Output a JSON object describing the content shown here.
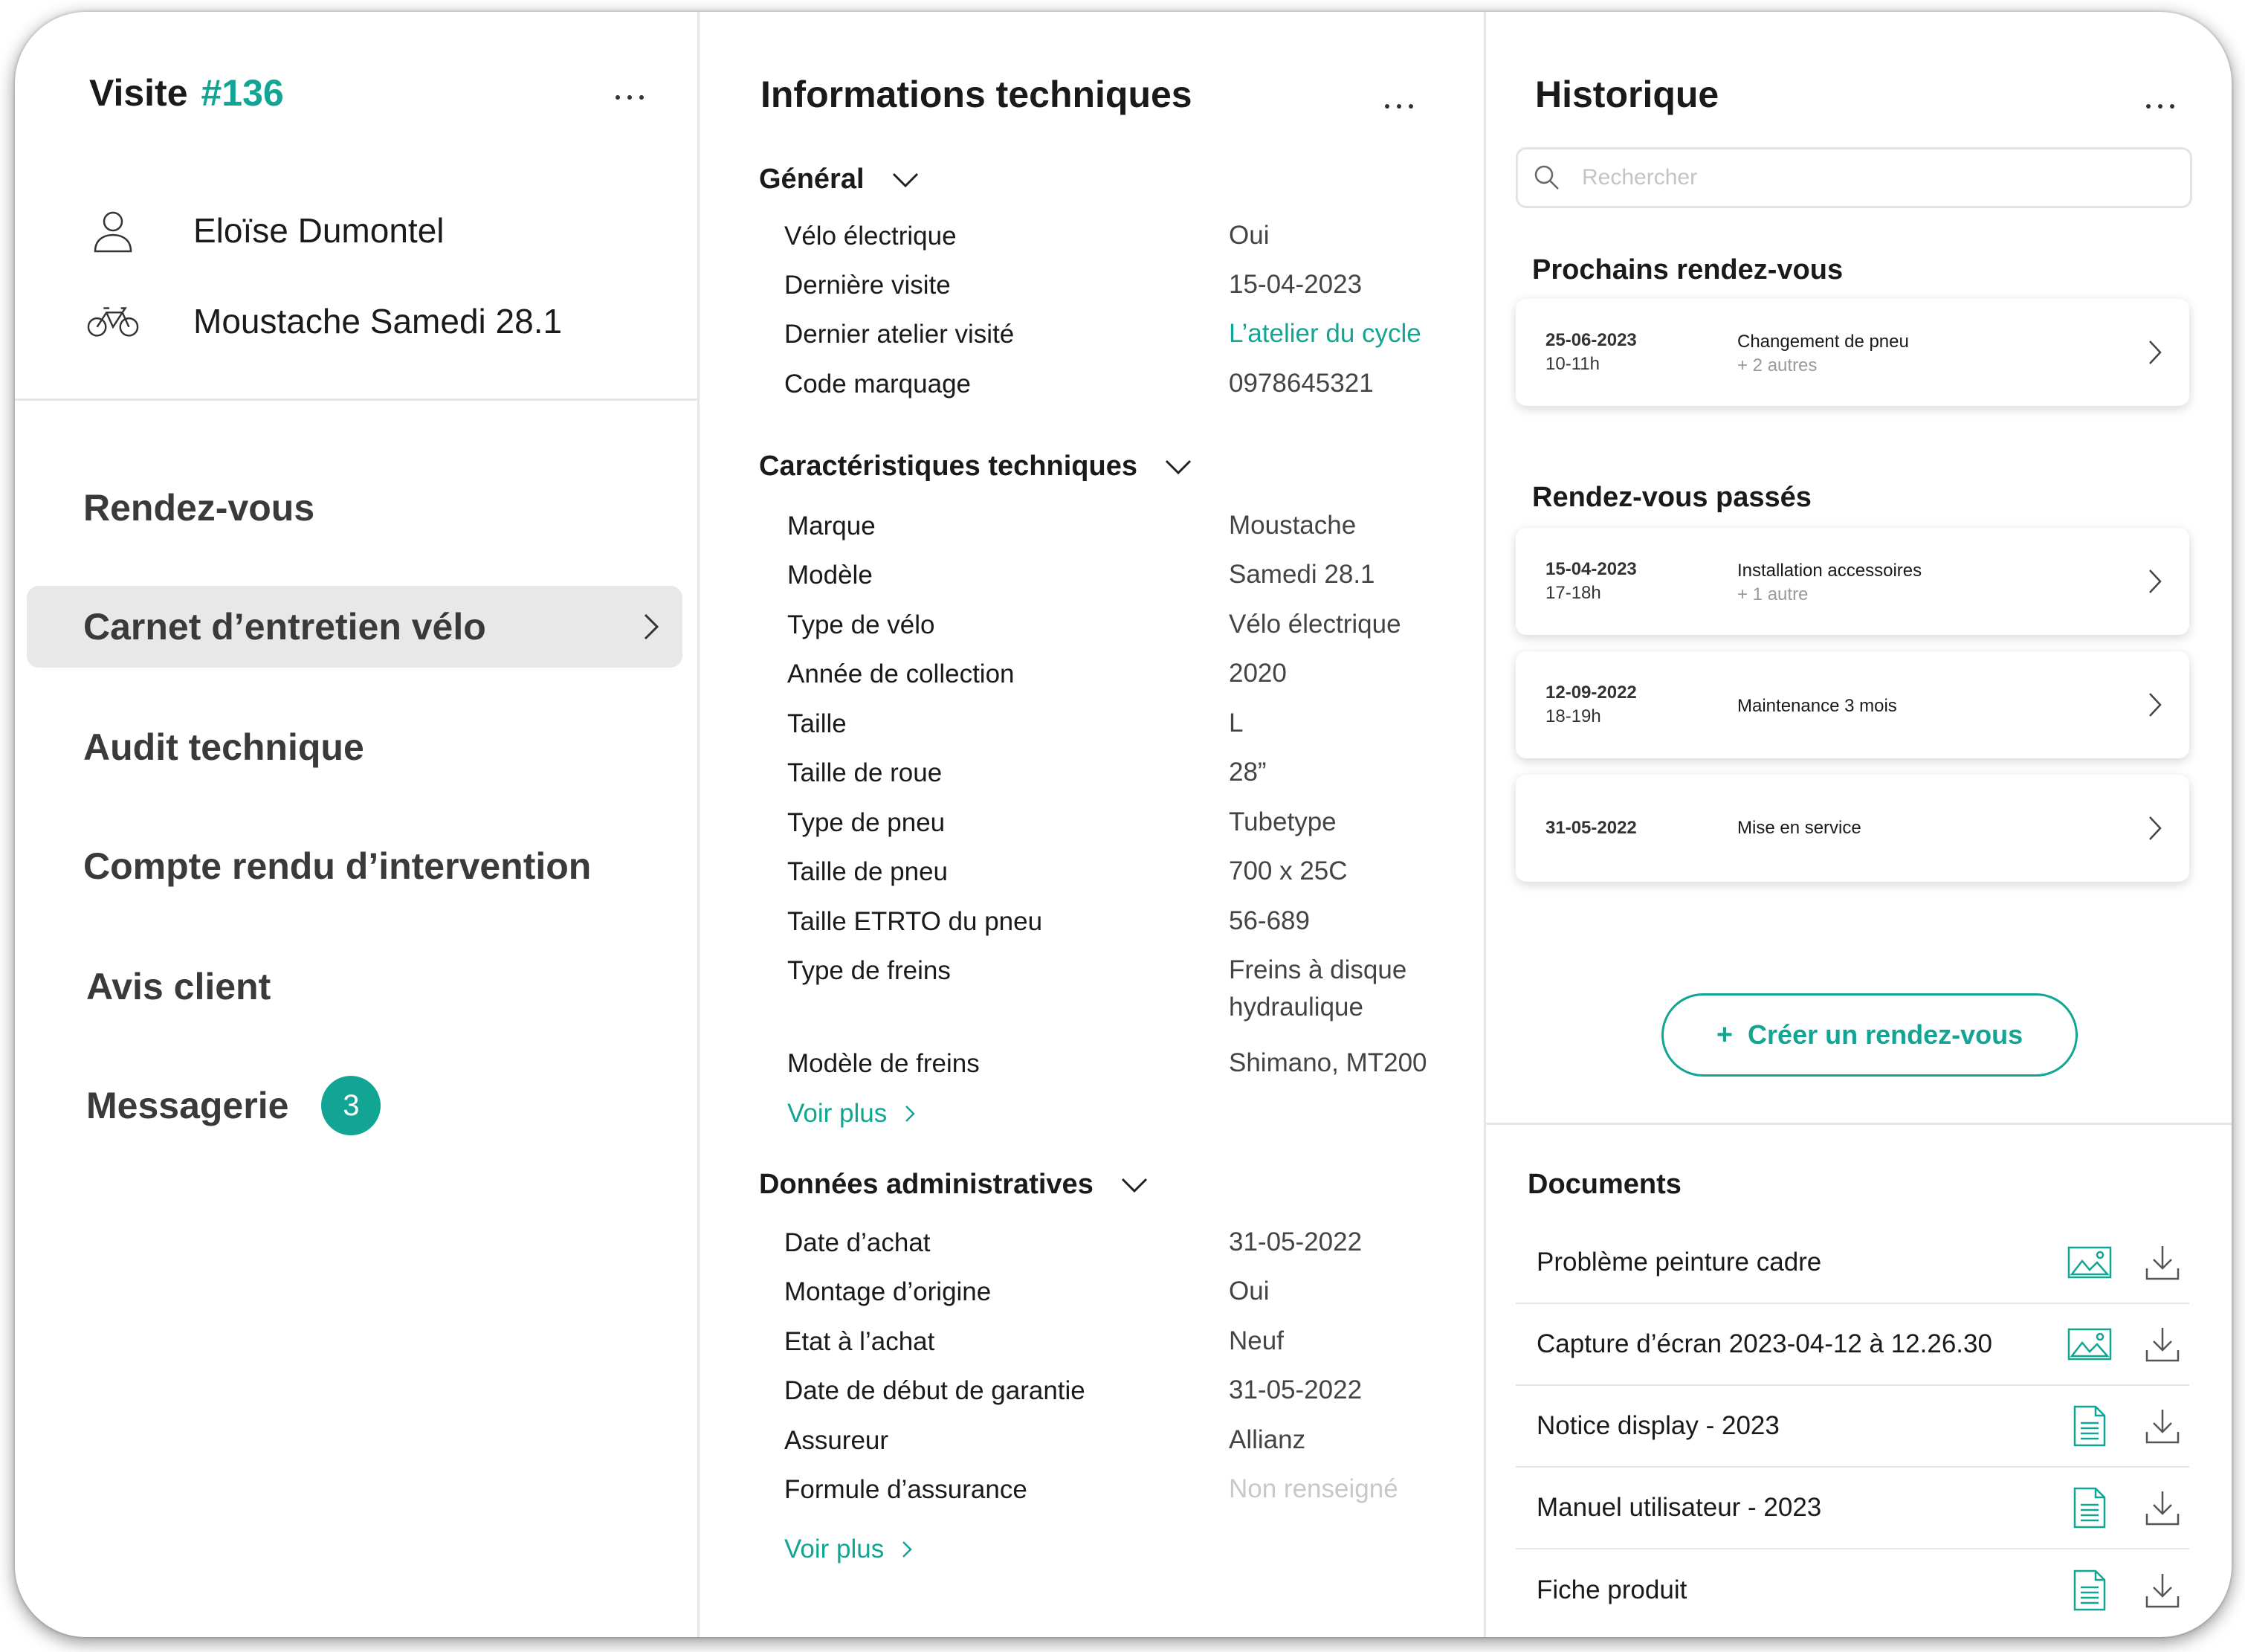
{
  "visit": {
    "label": "Visite",
    "number": "#136",
    "client_name": "Eloïse Dumontel",
    "bike_name": "Moustache Samedi 28.1",
    "icons": {
      "client": "user-icon",
      "bike": "bicycle-icon",
      "menu": "more-dots-icon"
    }
  },
  "nav": {
    "items": [
      {
        "label": "Rendez-vous"
      },
      {
        "label": "Carnet d’entretien vélo"
      },
      {
        "label": "Audit technique"
      },
      {
        "label": "Compte rendu d’intervention"
      },
      {
        "label": "Avis client"
      },
      {
        "label": "Messagerie",
        "badge": "3"
      }
    ],
    "active_index": 1
  },
  "tech": {
    "title": "Informations techniques",
    "general": {
      "title": "Général",
      "rows": [
        {
          "label": "Vélo électrique",
          "value": "Oui"
        },
        {
          "label": "Dernière visite",
          "value": "15-04-2023"
        },
        {
          "label": "Dernier atelier visité",
          "value": "L’atelier du cycle"
        },
        {
          "label": "Code marquage",
          "value": "0978645321"
        }
      ]
    },
    "specs": {
      "title": "Caractéristiques techniques",
      "rows": [
        {
          "label": "Marque",
          "value": "Moustache"
        },
        {
          "label": "Modèle",
          "value": "Samedi 28.1"
        },
        {
          "label": "Type de vélo",
          "value": "Vélo électrique"
        },
        {
          "label": "Année de collection",
          "value": "2020"
        },
        {
          "label": "Taille",
          "value": "L"
        },
        {
          "label": "Taille de roue",
          "value": "28”"
        },
        {
          "label": "Type de pneu",
          "value": "Tubetype"
        },
        {
          "label": "Taille de pneu",
          "value": "700 x 25C"
        },
        {
          "label": "Taille ETRTO du pneu",
          "value": "56-689"
        },
        {
          "label": "Type de freins",
          "value": "Freins à disque",
          "value2": "hydraulique"
        },
        {
          "label": "Modèle de freins",
          "value": "Shimano, MT200"
        }
      ],
      "see_more": "Voir plus"
    },
    "admin": {
      "title": "Données administratives",
      "rows": [
        {
          "label": "Date d’achat",
          "value": "31-05-2022"
        },
        {
          "label": "Montage d’origine",
          "value": "Oui"
        },
        {
          "label": "Etat à l’achat",
          "value": "Neuf"
        },
        {
          "label": "Date de début de garantie",
          "value": "31-05-2022"
        },
        {
          "label": "Assureur",
          "value": "Allianz"
        },
        {
          "label": "Formule d’assurance",
          "value": "Non renseigné"
        }
      ],
      "see_more": "Voir plus"
    },
    "colors": {
      "accent": "#12a594",
      "muted": "#c8c8c8"
    }
  },
  "history": {
    "title": "Historique",
    "search_placeholder": "Rechercher",
    "upcoming_title": "Prochains rendez-vous",
    "upcoming": [
      {
        "date": "25-06-2023",
        "time": "10-11h",
        "service": "Changement de pneu",
        "more": "+ 2 autres"
      }
    ],
    "past_title": "Rendez-vous passés",
    "past": [
      {
        "date": "15-04-2023",
        "time": "17-18h",
        "service": "Installation accessoires",
        "more": "+ 1 autre"
      },
      {
        "date": "12-09-2022",
        "time": "18-19h",
        "service": "Maintenance 3 mois",
        "more": ""
      },
      {
        "date": "31-05-2022",
        "time": "",
        "service": "Mise en service",
        "more": ""
      }
    ],
    "create_button": "Créer un rendez-vous"
  },
  "documents": {
    "title": "Documents",
    "items": [
      {
        "name": "Problème peinture cadre",
        "type": "image"
      },
      {
        "name": "Capture d’écran 2023-04-12 à 12.26.30",
        "type": "image"
      },
      {
        "name": "Notice display - 2023",
        "type": "file"
      },
      {
        "name": "Manuel utilisateur - 2023",
        "type": "file"
      },
      {
        "name": "Fiche produit",
        "type": "file"
      }
    ]
  }
}
